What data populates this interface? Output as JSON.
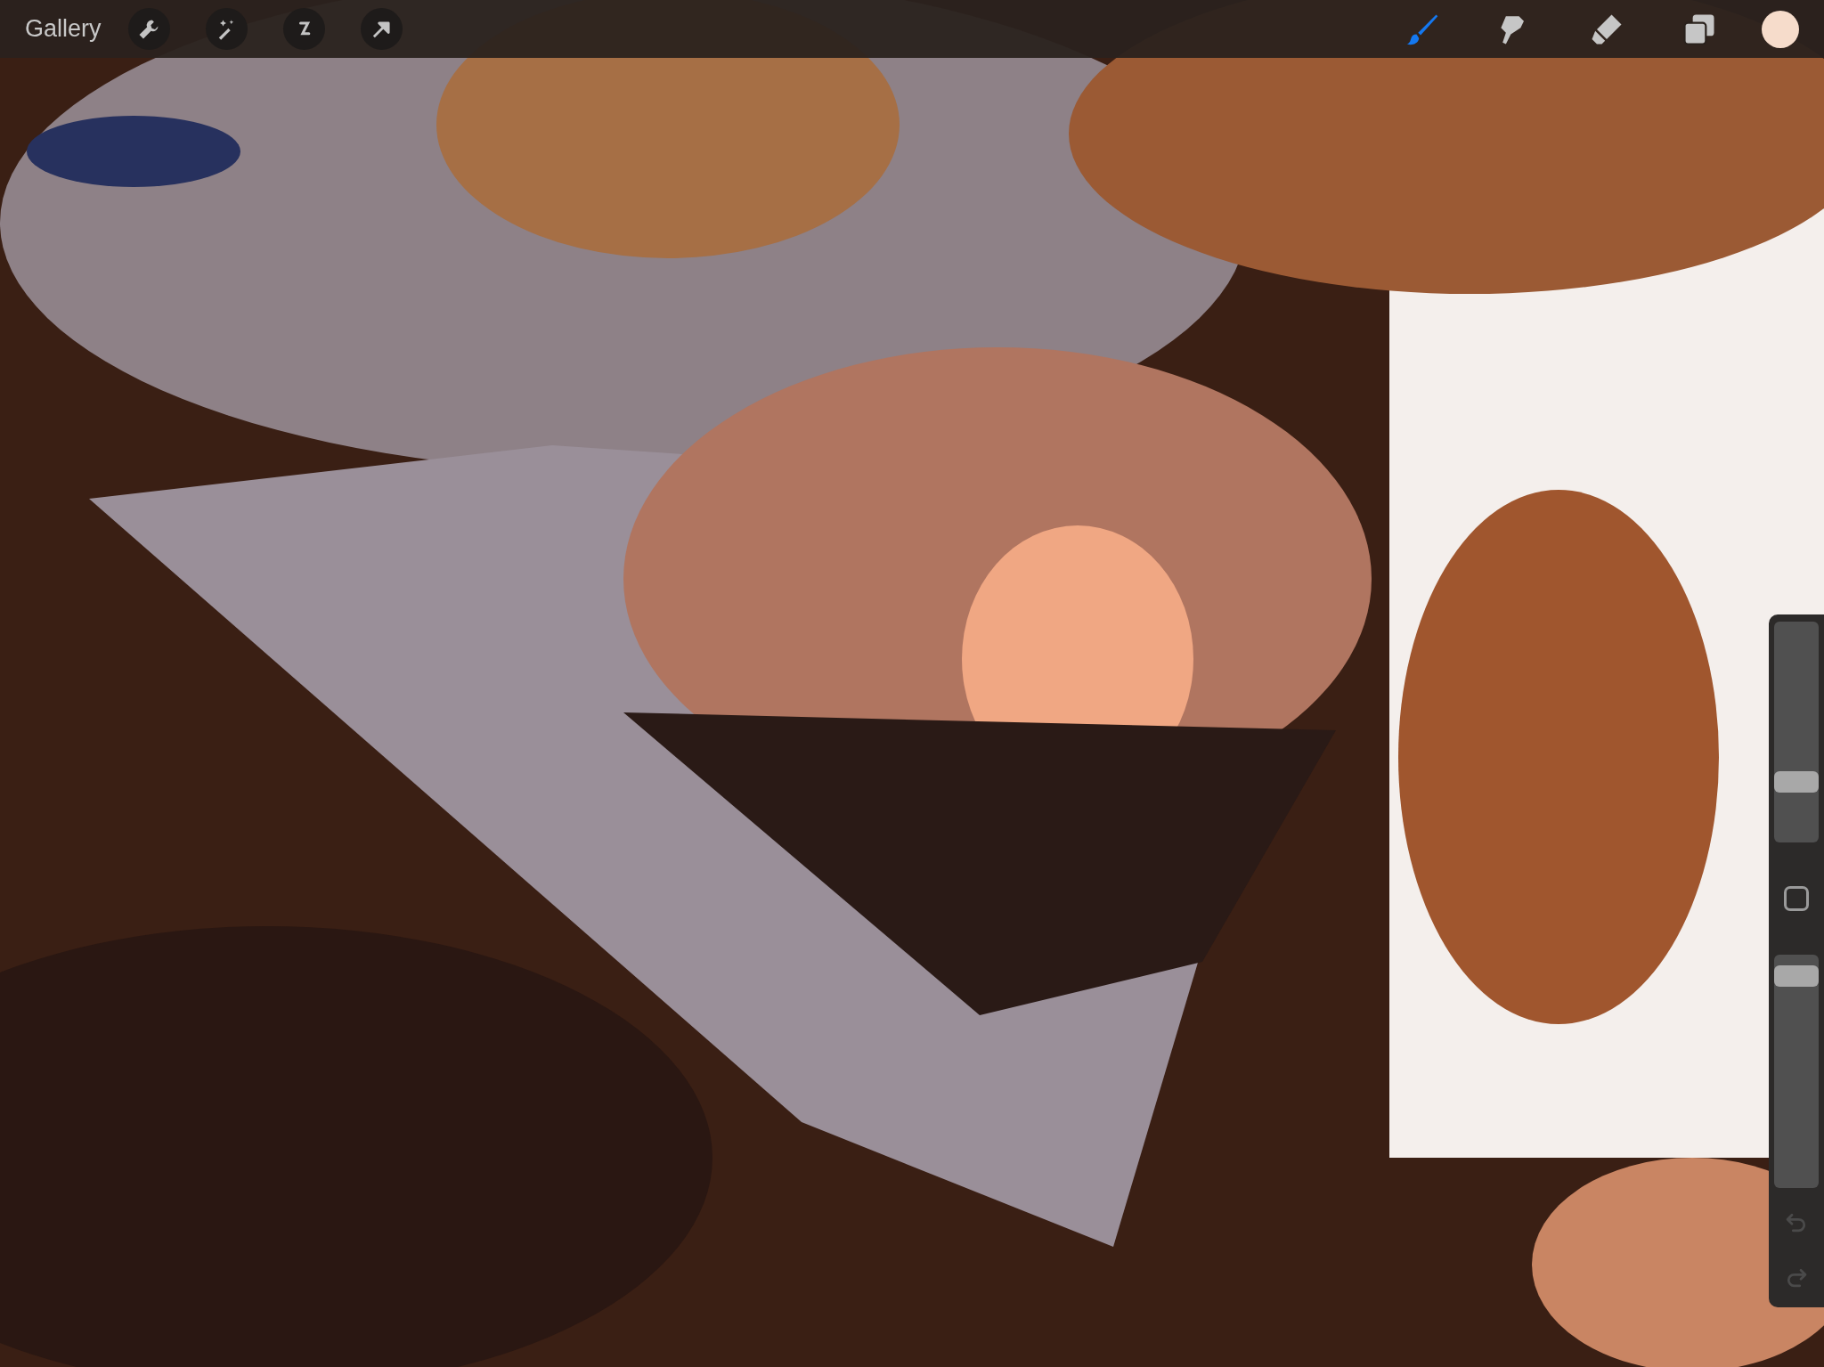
{
  "top_bar": {
    "gallery": "Gallery",
    "actions": [
      {
        "kind": "wrench"
      },
      {
        "kind": "wand"
      },
      {
        "kind": "selection"
      },
      {
        "kind": "transform"
      }
    ],
    "tools": [
      {
        "kind": "brush",
        "selected": true
      },
      {
        "kind": "smudge",
        "selected": false
      },
      {
        "kind": "eraser",
        "selected": false
      },
      {
        "kind": "layers",
        "selected": false
      }
    ],
    "current_color": {
      "color": "#f6dccb"
    }
  },
  "sidebar": {
    "size_slider": {
      "level": 0.25
    },
    "opacity_slider": {
      "level": 0.95
    },
    "undo": {
      "disabled": true
    },
    "redo": {
      "disabled": true
    }
  }
}
